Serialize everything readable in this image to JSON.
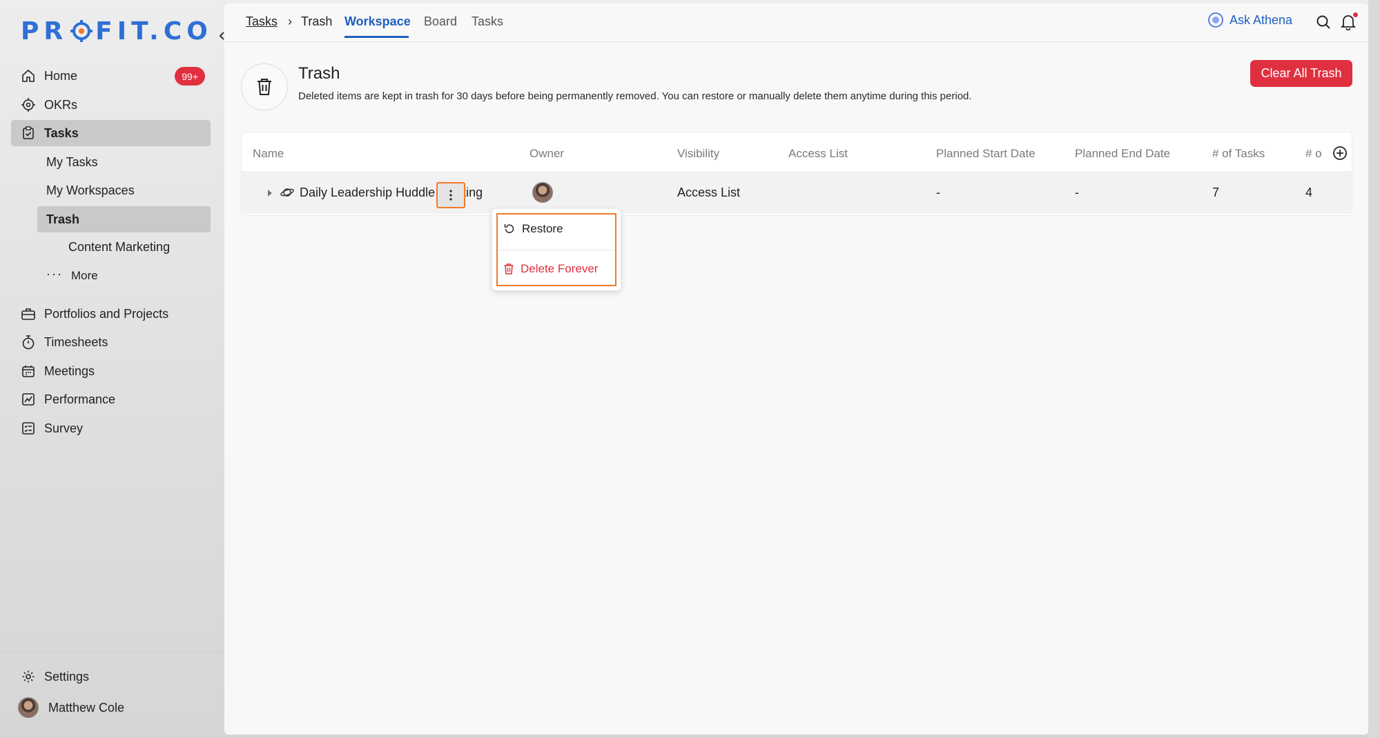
{
  "brand": {
    "logo_text_left": "PR",
    "logo_text_right": "FIT.CO",
    "accent": "#2f6fd6"
  },
  "sidebar": {
    "collapse_icon": "chevron-left-icon",
    "items": [
      {
        "label": "Home",
        "icon": "home-icon",
        "badge": "99+"
      },
      {
        "label": "OKRs",
        "icon": "target-icon"
      },
      {
        "label": "Tasks",
        "icon": "clipboard-check-icon",
        "active": true
      }
    ],
    "task_subitems": [
      {
        "label": "My Tasks"
      },
      {
        "label": "My Workspaces"
      },
      {
        "label": "Trash",
        "active": true
      },
      {
        "label": "Content Marketing"
      },
      {
        "label": "More"
      }
    ],
    "items_bottom": [
      {
        "label": "Portfolios and Projects",
        "icon": "briefcase-icon"
      },
      {
        "label": "Timesheets",
        "icon": "stopwatch-icon"
      },
      {
        "label": "Meetings",
        "icon": "calendar-icon"
      },
      {
        "label": "Performance",
        "icon": "chart-line-icon"
      },
      {
        "label": "Survey",
        "icon": "survey-icon"
      }
    ],
    "settings_label": "Settings",
    "user_name": "Matthew Cole"
  },
  "topbar": {
    "breadcrumb_root": "Tasks",
    "breadcrumb_sep": "›",
    "breadcrumb_current": "Trash",
    "tabs": [
      {
        "label": "Workspace",
        "active": true
      },
      {
        "label": "Board"
      },
      {
        "label": "Tasks"
      }
    ],
    "ask_label": "Ask Athena"
  },
  "header": {
    "title": "Trash",
    "description": "Deleted items are kept in trash for 30 days before being permanently removed. You can restore or manually delete them anytime during this period.",
    "clear_button": "Clear All Trash"
  },
  "table": {
    "columns": [
      "Name",
      "Owner",
      "Visibility",
      "Access List",
      "Planned Start Date",
      "Planned End Date",
      "# of Tasks",
      "# o"
    ],
    "rows": [
      {
        "name": "Daily Leadership Huddle Meeting",
        "visibility": "Access List",
        "access_list": "",
        "start": "-",
        "end": "-",
        "tasks": "7",
        "other": "4"
      }
    ]
  },
  "menu": {
    "restore": "Restore",
    "delete": "Delete Forever",
    "delete_color": "#e0303f"
  }
}
